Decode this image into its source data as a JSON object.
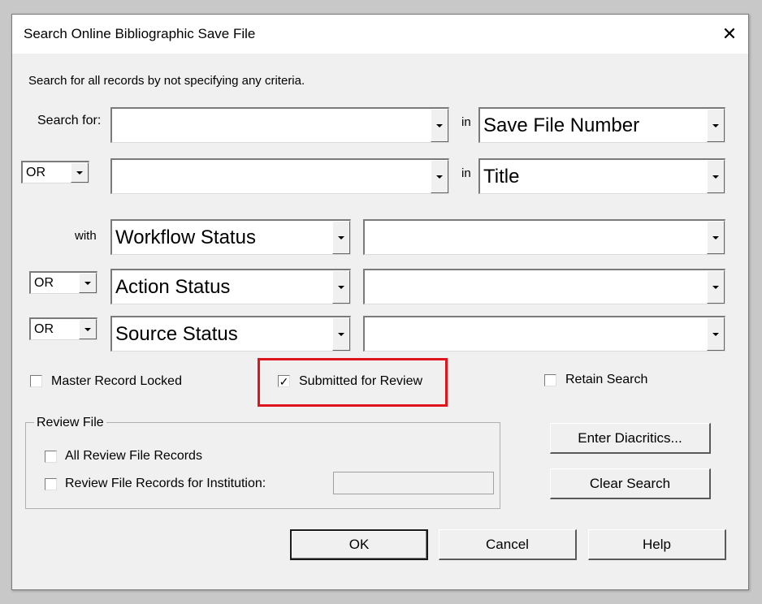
{
  "window": {
    "title": "Search Online Bibliographic Save File",
    "close_glyph": "✕"
  },
  "instructions": "Search for all records by not specifying any criteria.",
  "search_rows": [
    {
      "prefix_label": "Search for:",
      "operator": null,
      "value": "",
      "in_label": "in",
      "field": "Save File Number"
    },
    {
      "prefix_label": null,
      "operator": "OR",
      "value": "",
      "in_label": "in",
      "field": "Title"
    }
  ],
  "status_rows": [
    {
      "prefix_label": "with",
      "operator": null,
      "field": "Workflow Status",
      "value": ""
    },
    {
      "prefix_label": null,
      "operator": "OR",
      "field": "Action Status",
      "value": ""
    },
    {
      "prefix_label": null,
      "operator": "OR",
      "field": "Source Status",
      "value": ""
    }
  ],
  "checkboxes": {
    "master_record_locked": {
      "label": "Master Record Locked",
      "checked": false
    },
    "submitted_for_review": {
      "label": "Submitted for Review",
      "checked": true,
      "highlighted": true
    },
    "retain_search": {
      "label": "Retain Search",
      "checked": false
    }
  },
  "review_file": {
    "title": "Review File",
    "all_records": {
      "label": "All Review File Records",
      "checked": false
    },
    "institution_records": {
      "label": "Review File Records for Institution:",
      "checked": false,
      "value": ""
    }
  },
  "buttons": {
    "enter_diacritics": "Enter Diacritics...",
    "clear_search": "Clear Search",
    "ok": "OK",
    "cancel": "Cancel",
    "help": "Help"
  },
  "colors": {
    "highlight": "#e0141c",
    "dialog_bg": "#f0f0f0"
  },
  "check_glyph": "✓"
}
